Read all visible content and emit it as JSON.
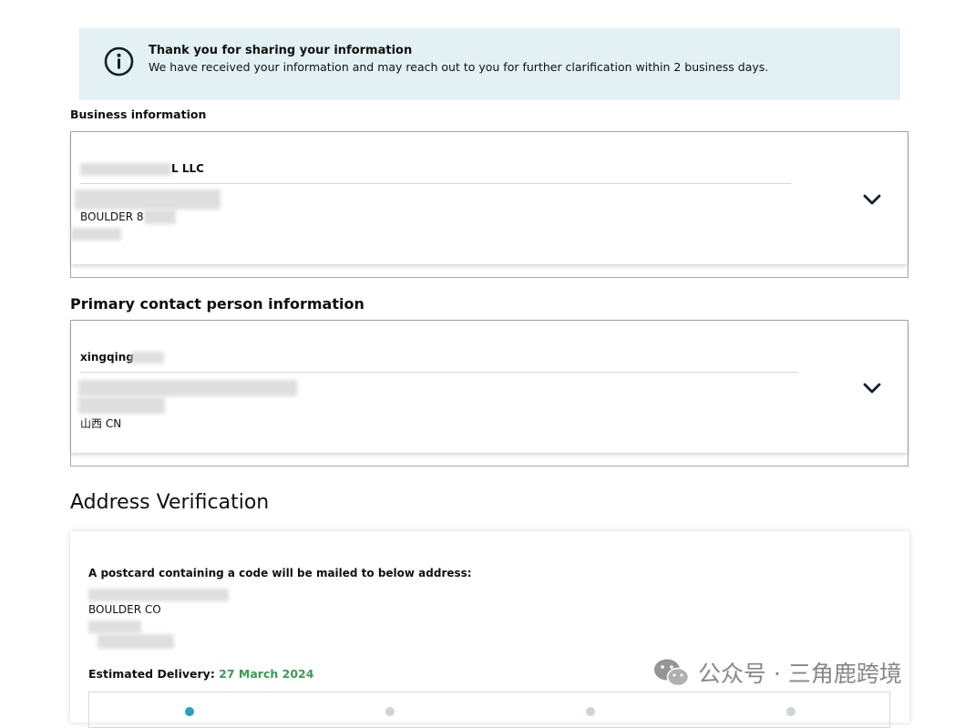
{
  "banner": {
    "title": "Thank you for sharing your information",
    "message": "We have received your information and may reach out to you for further clarification within 2 business days.",
    "icon": "info-icon"
  },
  "business": {
    "section_label": "Business information",
    "name_suffix": "L LLC",
    "address_line": "BOULDER 8"
  },
  "contact": {
    "section_label": "Primary contact person information",
    "name": "xingqing",
    "region": "山西 CN"
  },
  "address_verification": {
    "title": "Address Verification",
    "postcard_note": "A postcard containing a code will be mailed to below address:",
    "city_line": "BOULDER CO",
    "estimated_label": "Estimated Delivery:",
    "estimated_date": "27 March 2024"
  },
  "watermark": {
    "text": "公众号 · 三角鹿跨境"
  },
  "colors": {
    "banner_bg": "#e3f1f4",
    "date_green": "#3a9b53",
    "accent_teal": "#2aa0b9"
  }
}
